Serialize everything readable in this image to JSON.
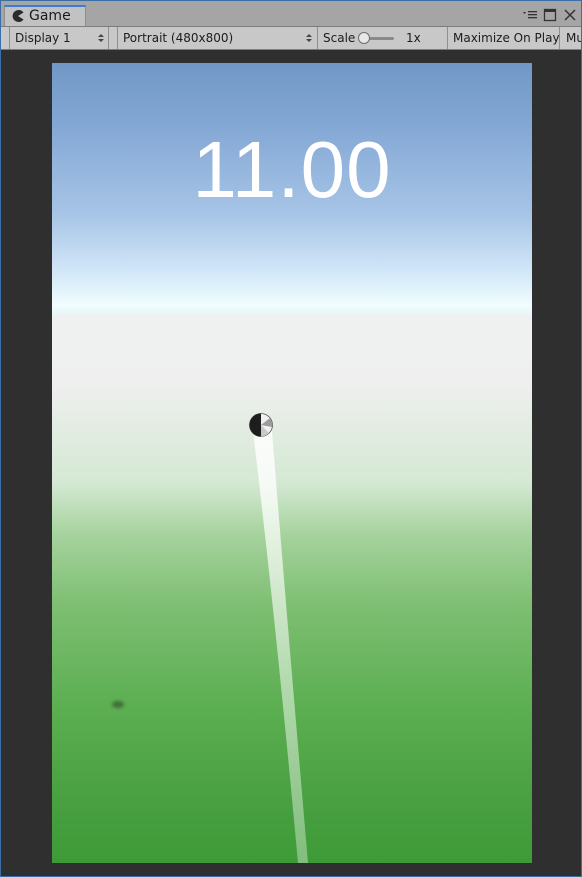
{
  "window": {
    "tab_label": "Game",
    "tab_icon": "pacman-game-icon",
    "controls": [
      "menu-icon",
      "maximize-icon",
      "close-icon"
    ]
  },
  "toolbar": {
    "display": "Display 1",
    "aspect": "Portrait (480x800)",
    "scale_label": "Scale",
    "scale_value": "1x",
    "scale_level": 0.0,
    "maximize_on_play": "Maximize On Play",
    "mute_partial": "Mu"
  },
  "game": {
    "score": "11.00"
  },
  "colors": {
    "sky_top": "#7197c6",
    "horizon": "#f1fdff",
    "ground_near": "#3e9a37",
    "accent_tab": "#3d7bd6"
  }
}
